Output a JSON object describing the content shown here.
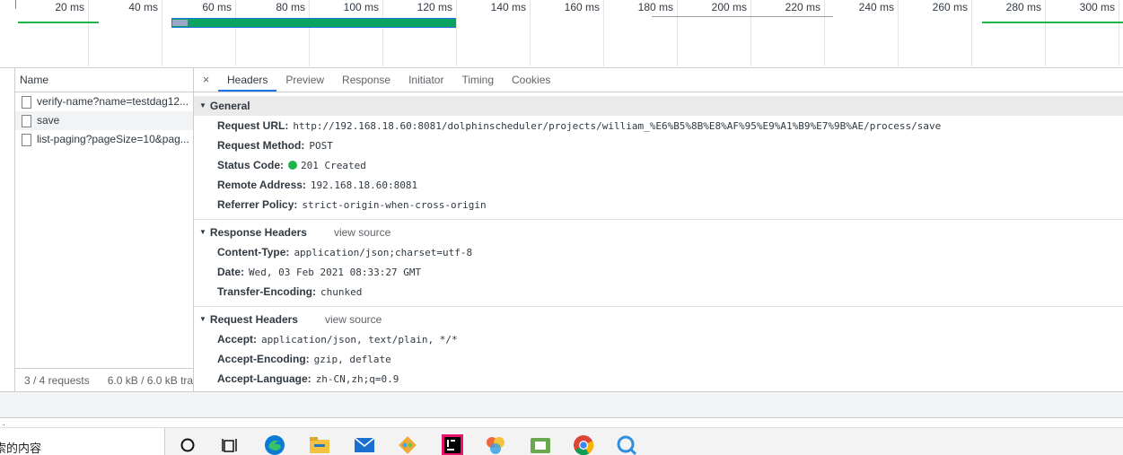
{
  "timeline": {
    "ticks": [
      "20 ms",
      "40 ms",
      "60 ms",
      "80 ms",
      "100 ms",
      "120 ms",
      "140 ms",
      "160 ms",
      "180 ms",
      "200 ms",
      "220 ms",
      "240 ms",
      "260 ms",
      "280 ms",
      "300 ms"
    ]
  },
  "request_list": {
    "column_name": "Name",
    "items": [
      {
        "name": "verify-name?name=testdag12...",
        "selected": false
      },
      {
        "name": "save",
        "selected": true
      },
      {
        "name": "list-paging?pageSize=10&pag...",
        "selected": false
      }
    ],
    "status": {
      "requests": "3 / 4 requests",
      "transferred": "6.0 kB / 6.0 kB tra"
    }
  },
  "detail": {
    "close_symbol": "×",
    "tabs": [
      "Headers",
      "Preview",
      "Response",
      "Initiator",
      "Timing",
      "Cookies"
    ],
    "active_tab": "Headers",
    "general": {
      "title": "General",
      "rows": [
        {
          "key": "Request URL:",
          "value": "http://192.168.18.60:8081/dolphinscheduler/projects/william_%E6%B5%8B%E8%AF%95%E9%A1%B9%E7%9B%AE/process/save"
        },
        {
          "key": "Request Method:",
          "value": "POST"
        },
        {
          "key": "Status Code:",
          "value": "201 Created"
        },
        {
          "key": "Remote Address:",
          "value": "192.168.18.60:8081"
        },
        {
          "key": "Referrer Policy:",
          "value": "strict-origin-when-cross-origin"
        }
      ]
    },
    "response_headers": {
      "title": "Response Headers",
      "view_source": "view source",
      "rows": [
        {
          "key": "Content-Type:",
          "value": "application/json;charset=utf-8"
        },
        {
          "key": "Date:",
          "value": "Wed, 03 Feb 2021 08:33:27 GMT"
        },
        {
          "key": "Transfer-Encoding:",
          "value": "chunked"
        }
      ]
    },
    "request_headers": {
      "title": "Request Headers",
      "view_source": "view source",
      "rows": [
        {
          "key": "Accept:",
          "value": "application/json, text/plain, */*"
        },
        {
          "key": "Accept-Encoding:",
          "value": "gzip, deflate"
        },
        {
          "key": "Accept-Language:",
          "value": "zh-CN,zh;q=0.9"
        }
      ]
    }
  },
  "taskbar": {
    "search_text": "索的内容",
    "dot": "·",
    "icons": [
      "cortana-icon",
      "task-view-icon",
      "edge-icon",
      "file-explorer-icon",
      "mail-icon",
      "git-icon",
      "intellij-icon",
      "browser-icon",
      "app-icon",
      "chrome-icon",
      "search-app-icon"
    ]
  }
}
